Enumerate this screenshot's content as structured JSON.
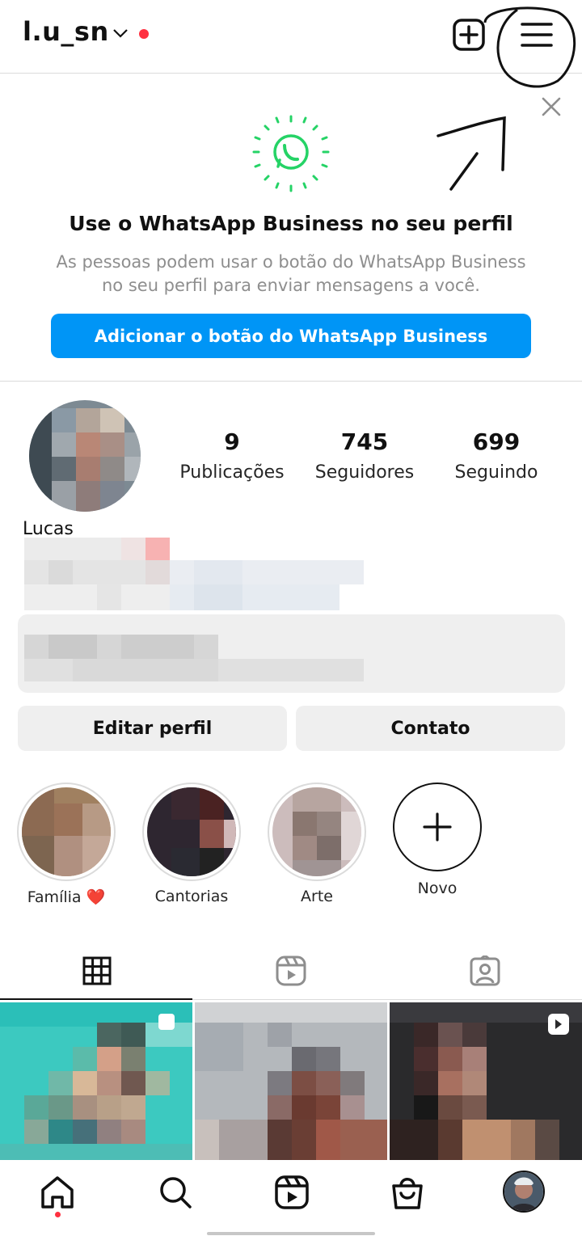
{
  "header": {
    "username": "l.u_sn",
    "icons": [
      "chevron-down-icon",
      "notification-dot",
      "add-post-icon",
      "menu-icon"
    ]
  },
  "banner": {
    "title": "Use o WhatsApp Business no seu perfil",
    "description": "As pessoas podem usar o botão do WhatsApp Business no seu perfil para enviar mensagens a você.",
    "button_label": "Adicionar o botão do WhatsApp Business",
    "accent_color": "#25d366",
    "button_color": "#0095f6"
  },
  "profile": {
    "name": "Lucas",
    "stats": [
      {
        "value": "9",
        "label": "Publicações"
      },
      {
        "value": "745",
        "label": "Seguidores"
      },
      {
        "value": "699",
        "label": "Seguindo"
      }
    ],
    "edit_button": "Editar perfil",
    "contact_button": "Contato"
  },
  "highlights": [
    {
      "label": "Família ❤️"
    },
    {
      "label": "Cantorias"
    },
    {
      "label": "Arte"
    },
    {
      "label": "Novo"
    }
  ],
  "tabs": [
    "grid-icon",
    "reels-icon",
    "tagged-icon"
  ],
  "bottom_nav": [
    "home-icon",
    "search-icon",
    "reels-icon",
    "shop-icon",
    "profile-avatar"
  ]
}
